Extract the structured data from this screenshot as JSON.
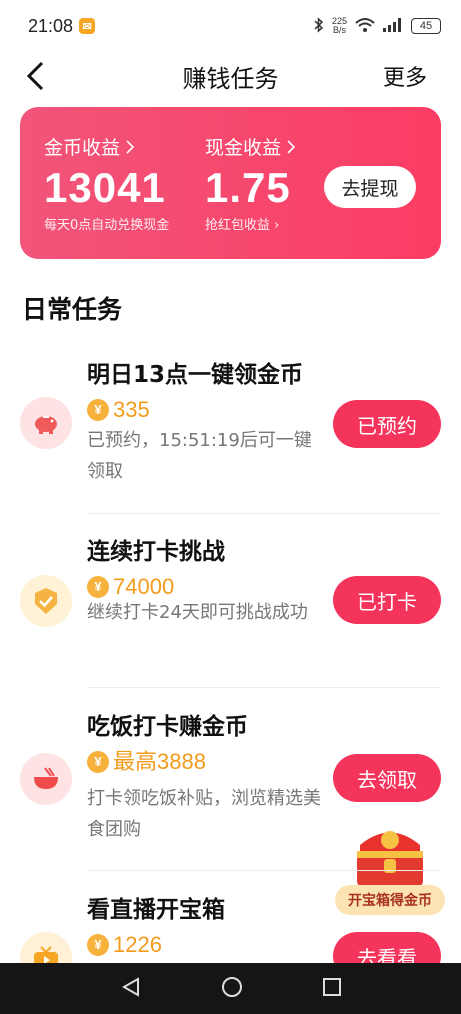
{
  "status_bar": {
    "time": "21:08",
    "net_speed_value": "225",
    "net_speed_unit": "B/s",
    "battery": "45"
  },
  "header": {
    "title": "赚钱任务",
    "more": "更多"
  },
  "earnings": {
    "coin_label": "金币收益",
    "coin_value": "13041",
    "coin_sub": "每天0点自动兑换现金",
    "cash_label": "现金收益",
    "cash_value": "1.75",
    "cash_sub": "抢红包收益",
    "withdraw_button": "去提现"
  },
  "section_title": "日常任务",
  "tasks": [
    {
      "title": "明日13点一键领金币",
      "reward": "335",
      "desc": "已预约，15:51:19后可一键领取",
      "button": "已预约",
      "icon": "piggy-bank-icon",
      "icon_bg": "#fde3e3",
      "icon_color": "#ef5b5b"
    },
    {
      "title": "连续打卡挑战",
      "reward": "74000",
      "desc": "继续打卡24天即可挑战成功",
      "button": "已打卡",
      "icon": "checkmark-badge-icon",
      "icon_bg": "#fff2d6",
      "icon_color": "#f5b342"
    },
    {
      "title": "吃饭打卡赚金币",
      "reward": "最高3888",
      "desc": "打卡领吃饭补贴，浏览精选美食团购",
      "button": "去领取",
      "icon": "food-bowl-icon",
      "icon_bg": "#fde3e3",
      "icon_color": "#ef4b4b"
    },
    {
      "title": "看直播开宝箱",
      "reward": "1226",
      "desc": "",
      "button": "去看看",
      "icon": "tv-icon",
      "icon_bg": "#fff0d6",
      "icon_color": "#f5a623"
    }
  ],
  "treasure": {
    "label": "开宝箱得金币"
  },
  "colors": {
    "accent": "#f4345a",
    "coin": "#f39b1b"
  }
}
